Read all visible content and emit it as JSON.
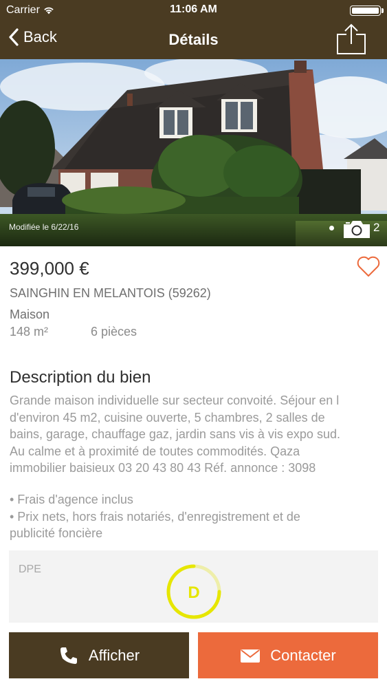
{
  "status": {
    "carrier": "Carrier",
    "time": "11:06 AM",
    "battery_level": 1.0
  },
  "nav": {
    "back_label": "Back",
    "title": "Détails",
    "share_icon": "share-icon"
  },
  "photo": {
    "modified": "Modifiée le 6/22/16",
    "count": "2",
    "camera_icon": "camera-icon"
  },
  "listing": {
    "price": "399,000 €",
    "city": "SAINGHIN EN MELANTOIS (59262)",
    "type": "Maison",
    "surface": "148 m²",
    "rooms": "6 pièces",
    "favorite_icon": "heart-icon"
  },
  "description": {
    "title": "Description du bien",
    "lines": [
      "Grande maison individuelle sur secteur convoité. Séjour en l",
      "d'environ 45 m2, cuisine ouverte, 5 chambres, 2 salles de",
      "bains, garage, chauffage gaz, jardin sans vis à vis expo sud.",
      "Au calme et à proximité de toutes commodités. Qaza",
      "immobilier baisieux 03 20 43 80 43 Réf. annonce : 3098"
    ],
    "bullets": [
      "• Frais d'agence inclus",
      "• Prix nets, hors frais notariés, d'enregistrement et de",
      "publicité foncière"
    ]
  },
  "dpe": {
    "label": "DPE",
    "rating": "D",
    "color": "#e6e600"
  },
  "actions": {
    "afficher_label": "Afficher",
    "contacter_label": "Contacter",
    "afficher_icon": "phone-icon",
    "contacter_icon": "envelope-icon"
  },
  "colors": {
    "brand_brown": "#4a3b22",
    "accent_orange": "#ec6a3c"
  }
}
